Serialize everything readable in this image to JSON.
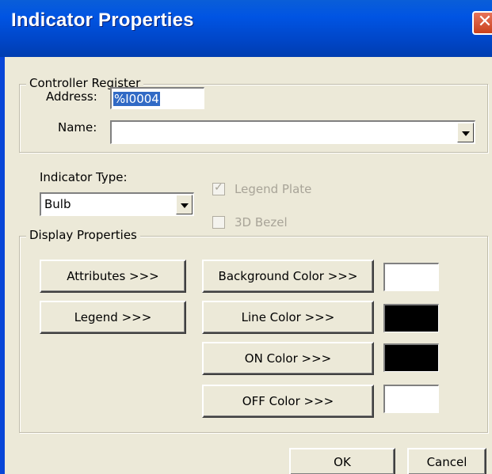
{
  "window": {
    "title": "Indicator Properties",
    "close_glyph": "✕"
  },
  "controller_register": {
    "legend": "Controller Register",
    "address_label": "Address:",
    "address_value": "%I0004",
    "name_label": "Name:",
    "name_value": ""
  },
  "indicator_type": {
    "label": "Indicator Type:",
    "selected": "Bulb"
  },
  "options": {
    "legend_plate_label": "Legend Plate",
    "legend_plate_checked": true,
    "legend_plate_enabled": false,
    "bezel_label": "3D Bezel",
    "bezel_checked": false,
    "bezel_enabled": false
  },
  "display_properties": {
    "legend": "Display Properties",
    "attributes_label": "Attributes >>>",
    "legend_button_label": "Legend >>>",
    "background_color_label": "Background Color >>>",
    "line_color_label": "Line Color >>>",
    "on_color_label": "ON Color >>>",
    "off_color_label": "OFF Color >>>",
    "colors": {
      "background": "#ffffff",
      "line": "#000000",
      "on": "#000000",
      "off": "#ffffff"
    }
  },
  "footer": {
    "ok_label": "OK",
    "cancel_label": "Cancel"
  }
}
